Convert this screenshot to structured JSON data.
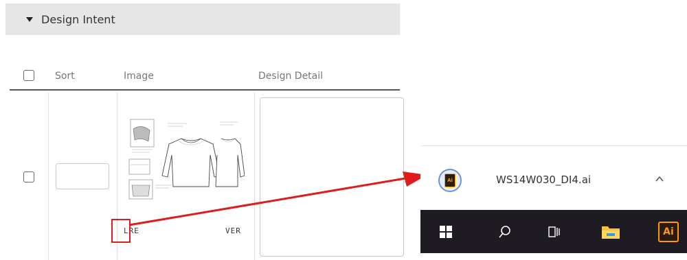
{
  "section": {
    "title": "Design Intent"
  },
  "table": {
    "headers": {
      "sort": "Sort",
      "image": "Image",
      "design_detail": "Design Detail"
    },
    "row": {
      "sort_value": "",
      "caption_left": "LRE",
      "caption_right": "VER"
    }
  },
  "download": {
    "file_name": "WS14W030_DI4.ai",
    "file_icon_text": "Ai"
  },
  "taskbar": {
    "illustrator_label": "Ai"
  },
  "colors": {
    "highlight": "#e01b1b",
    "taskbar": "#1f1b22",
    "illustrator": "#ff9a00"
  }
}
